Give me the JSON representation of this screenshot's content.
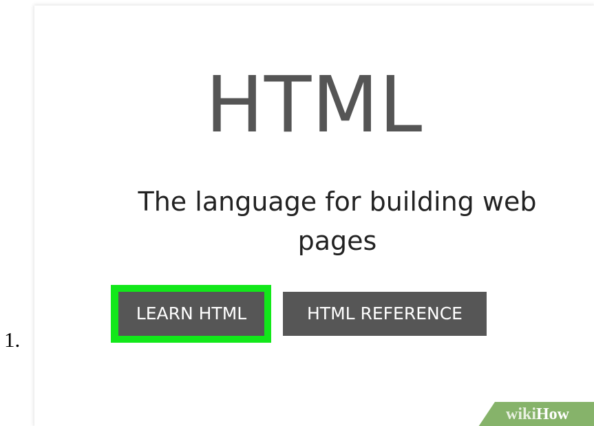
{
  "list_marker": "1.",
  "hero": {
    "title": "HTML",
    "subtitle_line1": "The language for building web",
    "subtitle_line2": "pages"
  },
  "buttons": {
    "learn": "LEARN HTML",
    "reference": "HTML REFERENCE"
  },
  "watermark": {
    "part1": "wiki",
    "part2": "How"
  },
  "colors": {
    "highlight": "#12e81a",
    "button_bg": "#565656",
    "title_color": "#555555",
    "watermark_green": "#86b36a"
  }
}
